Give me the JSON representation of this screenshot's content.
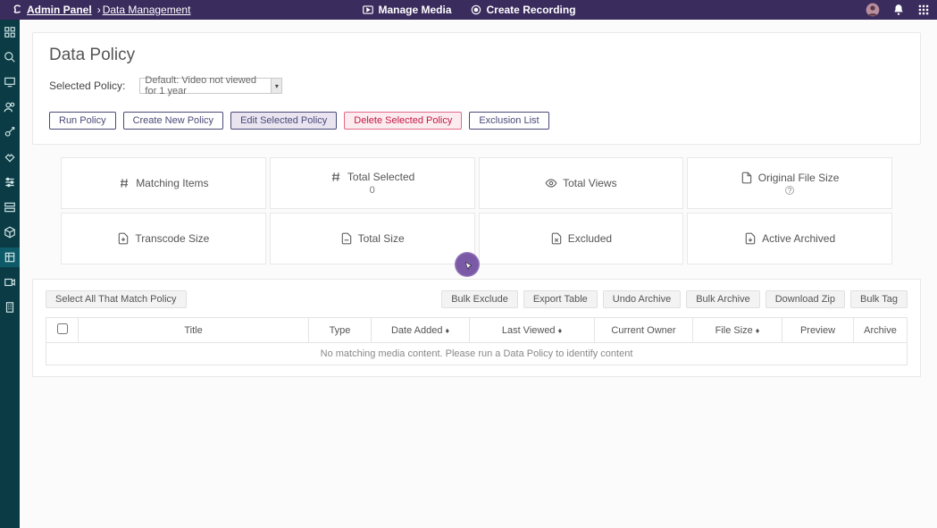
{
  "topbar": {
    "breadcrumb_root": "Admin Panel",
    "breadcrumb_page": "Data Management",
    "manage_media": "Manage Media",
    "create_recording": "Create Recording"
  },
  "page": {
    "title": "Data Policy",
    "selected_policy_label": "Selected Policy:",
    "selected_policy_value": "Default: Video not viewed for 1 year"
  },
  "policy_buttons": {
    "run": "Run Policy",
    "create": "Create New Policy",
    "edit": "Edit Selected Policy",
    "delete": "Delete Selected Policy",
    "exclusion": "Exclusion List"
  },
  "stats": {
    "matching_items": "Matching Items",
    "total_selected": "Total Selected",
    "total_selected_value": "0",
    "total_views": "Total Views",
    "original_file_size": "Original File Size",
    "original_file_size_help": "?",
    "transcode_size": "Transcode Size",
    "total_size": "Total Size",
    "excluded": "Excluded",
    "active_archived": "Active Archived"
  },
  "table_actions": {
    "select_all": "Select All That Match Policy",
    "bulk_exclude": "Bulk Exclude",
    "export_table": "Export Table",
    "undo_archive": "Undo Archive",
    "bulk_archive": "Bulk Archive",
    "download_zip": "Download Zip",
    "bulk_tag": "Bulk Tag"
  },
  "table": {
    "headers": {
      "title": "Title",
      "type": "Type",
      "date_added": "Date Added",
      "last_viewed": "Last Viewed",
      "current_owner": "Current Owner",
      "file_size": "File Size",
      "preview": "Preview",
      "archive": "Archive"
    },
    "empty_text": "No matching media content. Please run a Data Policy to identify content"
  }
}
